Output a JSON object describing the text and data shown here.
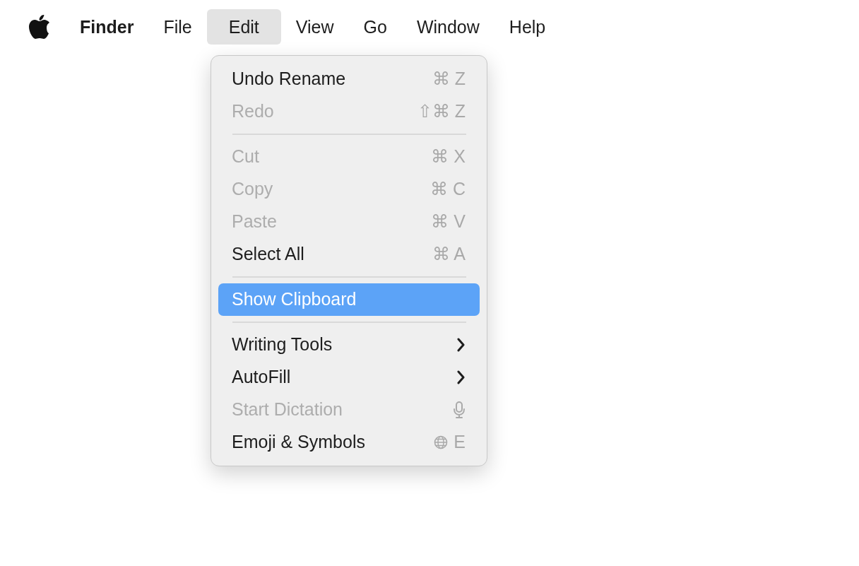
{
  "menubar": {
    "items": [
      {
        "label": "Finder",
        "kind": "app",
        "selected": false
      },
      {
        "label": "File",
        "kind": "menu",
        "selected": false
      },
      {
        "label": "Edit",
        "kind": "menu",
        "selected": true
      },
      {
        "label": "View",
        "kind": "menu",
        "selected": false
      },
      {
        "label": "Go",
        "kind": "menu",
        "selected": false
      },
      {
        "label": "Window",
        "kind": "menu",
        "selected": false
      },
      {
        "label": "Help",
        "kind": "menu",
        "selected": false
      }
    ]
  },
  "menu": {
    "items": [
      {
        "kind": "command",
        "label": "Undo Rename",
        "shortcut": "⌘ Z",
        "disabled": false,
        "selected": false
      },
      {
        "kind": "command",
        "label": "Redo",
        "shortcut": "⇧⌘ Z",
        "disabled": true,
        "selected": false
      },
      {
        "kind": "separator"
      },
      {
        "kind": "command",
        "label": "Cut",
        "shortcut": "⌘ X",
        "disabled": true,
        "selected": false
      },
      {
        "kind": "command",
        "label": "Copy",
        "shortcut": "⌘ C",
        "disabled": true,
        "selected": false
      },
      {
        "kind": "command",
        "label": "Paste",
        "shortcut": "⌘ V",
        "disabled": true,
        "selected": false
      },
      {
        "kind": "command",
        "label": "Select All",
        "shortcut": "⌘ A",
        "disabled": false,
        "selected": false
      },
      {
        "kind": "separator"
      },
      {
        "kind": "command",
        "label": "Show Clipboard",
        "disabled": false,
        "selected": true
      },
      {
        "kind": "separator"
      },
      {
        "kind": "submenu",
        "label": "Writing Tools",
        "disabled": false,
        "selected": false
      },
      {
        "kind": "submenu",
        "label": "AutoFill",
        "disabled": false,
        "selected": false
      },
      {
        "kind": "voice",
        "label": "Start Dictation",
        "disabled": true,
        "selected": false
      },
      {
        "kind": "emoji",
        "label": "Emoji & Symbols",
        "shortcut": "E",
        "disabled": false,
        "selected": false
      }
    ]
  }
}
